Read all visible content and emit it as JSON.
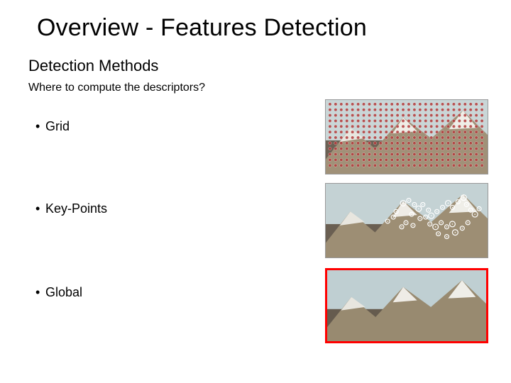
{
  "title": "Overview - Features Detection",
  "subtitle": "Detection Methods",
  "question": "Where to compute the descriptors?",
  "bullets": {
    "b1": "Grid",
    "b2": "Key-Points",
    "b3": "Global"
  }
}
